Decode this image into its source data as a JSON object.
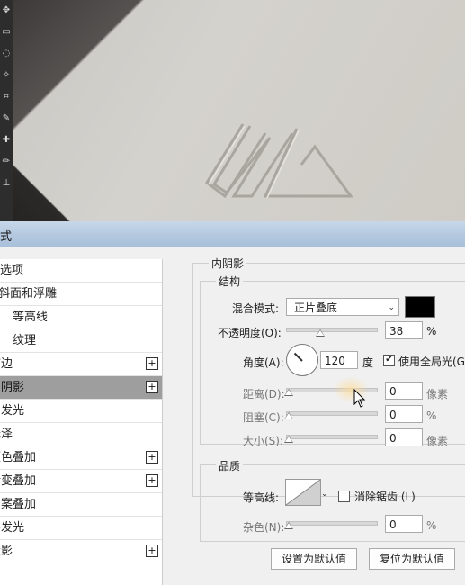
{
  "dialog": {
    "title": "式"
  },
  "styles_list": [
    {
      "label": "选项",
      "has_plus": false,
      "active": false
    },
    {
      "label": "斜面和浮雕",
      "has_plus": false,
      "active": false
    },
    {
      "label": "等高线",
      "has_plus": false,
      "active": false
    },
    {
      "label": "纹理",
      "has_plus": false,
      "active": false
    },
    {
      "label": "描边",
      "has_plus": true,
      "active": false
    },
    {
      "label": "内阴影",
      "has_plus": true,
      "active": true
    },
    {
      "label": "内发光",
      "has_plus": false,
      "active": false
    },
    {
      "label": "光泽",
      "has_plus": false,
      "active": false
    },
    {
      "label": "颜色叠加",
      "has_plus": true,
      "active": false
    },
    {
      "label": "渐变叠加",
      "has_plus": true,
      "active": false
    },
    {
      "label": "图案叠加",
      "has_plus": false,
      "active": false
    },
    {
      "label": "外发光",
      "has_plus": false,
      "active": false
    },
    {
      "label": "投影",
      "has_plus": true,
      "active": false
    }
  ],
  "inner_shadow": {
    "group_title": "内阴影",
    "structure": {
      "title": "结构",
      "blend_mode_label": "混合模式:",
      "blend_mode_value": "正片叠底",
      "shadow_color": "#000000",
      "opacity_label": "不透明度(O):",
      "opacity_value": "38",
      "opacity_unit": "%",
      "angle_label": "角度(A):",
      "angle_value": "120",
      "angle_unit": "度",
      "global_light_label": "使用全局光(G",
      "global_light_checked": true,
      "distance_label": "距离(D):",
      "distance_value": "0",
      "distance_unit": "像素",
      "choke_label": "阻塞(C):",
      "choke_value": "0",
      "choke_unit": "%",
      "size_label": "大小(S):",
      "size_value": "0",
      "size_unit": "像素"
    },
    "quality": {
      "title": "品质",
      "contour_label": "等高线:",
      "antialias_label": "消除锯齿 (L)",
      "antialias_checked": false,
      "noise_label": "杂色(N):",
      "noise_value": "0",
      "noise_unit": "%"
    },
    "buttons": {
      "make_default": "设置为默认值",
      "reset_default": "复位为默认值"
    }
  }
}
